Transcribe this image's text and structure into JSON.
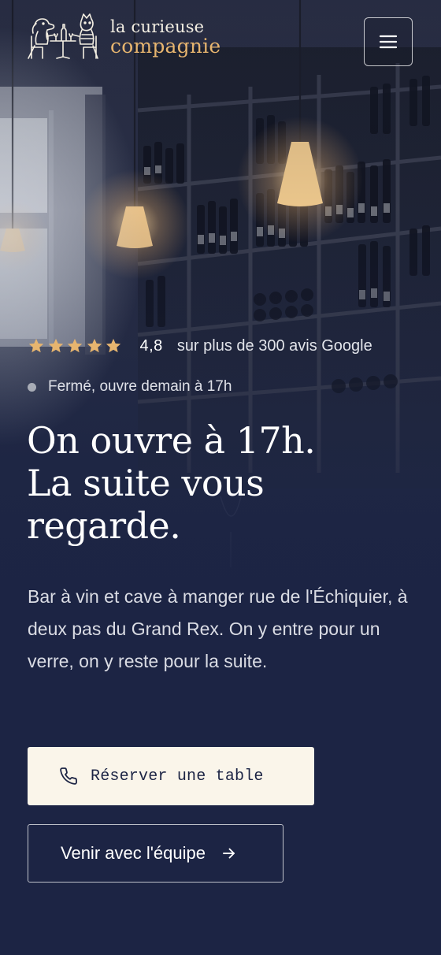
{
  "header": {
    "logo": {
      "line1": "la curieuse",
      "line2": "compagnie",
      "mark_icon": "cat-dog-wine-table-illustration"
    },
    "menu_icon": "hamburger-menu-icon"
  },
  "hero": {
    "rating": {
      "stars": 5,
      "score": "4,8",
      "text": "sur plus de 300 avis Google",
      "star_color": "#e7b56f"
    },
    "status": {
      "text": "Fermé, ouvre demain à 17h",
      "dot_color": "#a8acb6"
    },
    "headline": {
      "line1": "On ouvre à 17h.",
      "line2": "La suite vous",
      "line3": "regarde."
    },
    "description": "Bar à vin et cave à manger rue de l'Échiquier, à deux pas du Grand Rex. On y entre pour un verre, on y reste pour la suite.",
    "primary_button": {
      "label": "Réserver une table",
      "icon": "phone-icon"
    },
    "secondary_button": {
      "label": "Venir avec l'équipe",
      "icon": "arrow-right-icon"
    }
  },
  "colors": {
    "background": "#1c2444",
    "accent": "#e7b56f",
    "button_cream": "#faf5ea",
    "text": "#ffffff"
  }
}
